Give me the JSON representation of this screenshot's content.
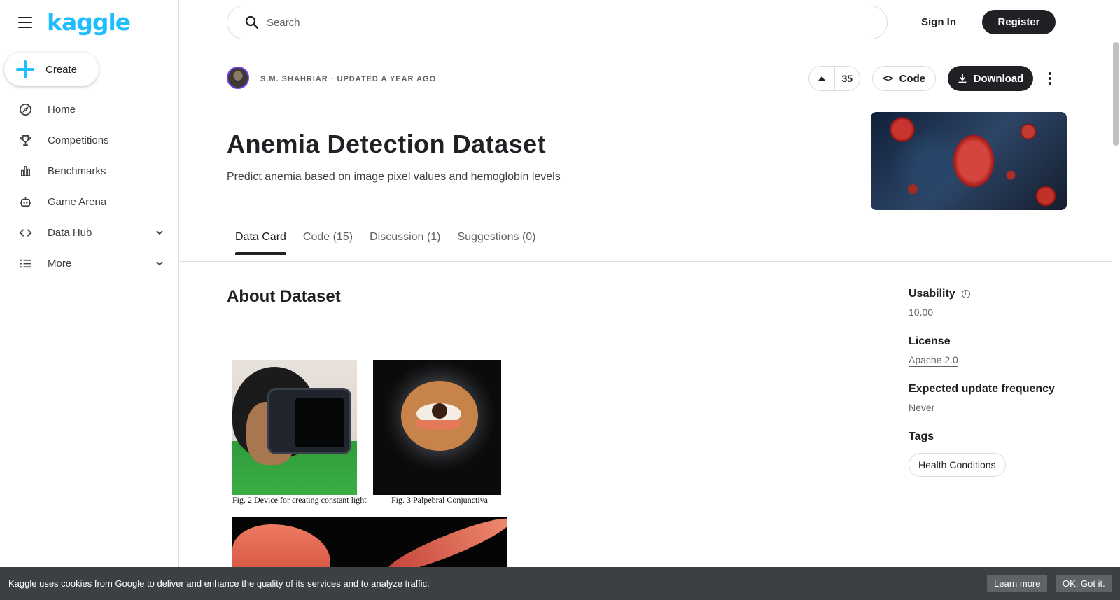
{
  "sidebar": {
    "logo": "kaggle",
    "create_label": "Create",
    "items": [
      {
        "label": "Home",
        "icon": "compass-icon"
      },
      {
        "label": "Competitions",
        "icon": "trophy-icon"
      },
      {
        "label": "Benchmarks",
        "icon": "bar-chart-icon"
      },
      {
        "label": "Game Arena",
        "icon": "robot-icon"
      },
      {
        "label": "Data Hub",
        "icon": "code-brackets-icon"
      },
      {
        "label": "More",
        "icon": "list-icon"
      }
    ]
  },
  "header": {
    "search_placeholder": "Search",
    "signin_label": "Sign In",
    "register_label": "Register"
  },
  "dataset": {
    "byline": "S.M. SHAHRIAR · UPDATED A YEAR AGO",
    "votes": "35",
    "code_label": "Code",
    "download_label": "Download",
    "title": "Anemia Detection Dataset",
    "subtitle": "Predict anemia based on image pixel values and hemoglobin levels"
  },
  "tabs": [
    {
      "label": "Data Card",
      "active": true
    },
    {
      "label": "Code (15)",
      "active": false
    },
    {
      "label": "Discussion (1)",
      "active": false
    },
    {
      "label": "Suggestions (0)",
      "active": false
    }
  ],
  "about": {
    "heading": "About Dataset",
    "fig2_caption": "Fig. 2 Device for creating constant light",
    "fig3_caption": "Fig. 3 Palpebral Conjunctiva"
  },
  "meta": {
    "usability_label": "Usability",
    "usability_value": "10.00",
    "license_label": "License",
    "license_value": "Apache 2.0",
    "frequency_label": "Expected update frequency",
    "frequency_value": "Never",
    "tags_label": "Tags",
    "tags": [
      "Health Conditions"
    ]
  },
  "cookie": {
    "text": "Kaggle uses cookies from Google to deliver and enhance the quality of its services and to analyze traffic.",
    "learn_more": "Learn more",
    "ok": "OK, Got it."
  },
  "colors": {
    "brand": "#20beff",
    "dark": "#202124",
    "avatar_ring": "#7b3ff2"
  }
}
